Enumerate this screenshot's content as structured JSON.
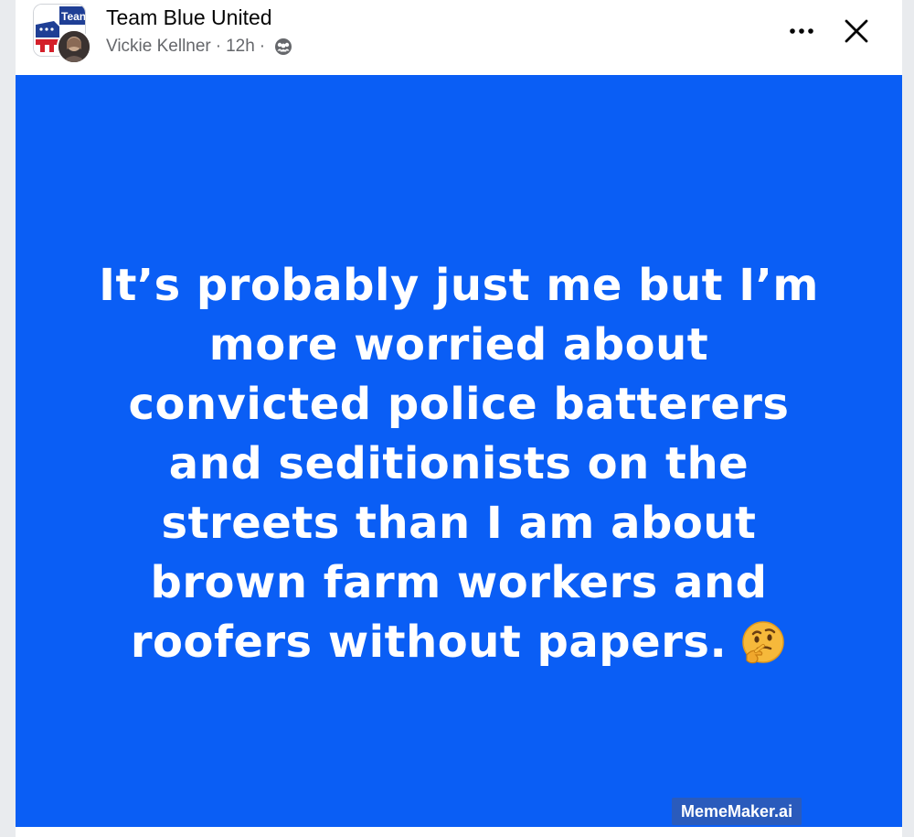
{
  "post": {
    "group_name": "Team Blue United",
    "group_logo_text": "Tean",
    "author": "Vickie Kellner",
    "separator": "·",
    "time": "12h",
    "audience_icon": "group-members-icon",
    "more_icon": "more-options-icon",
    "close_icon": "close-icon"
  },
  "meme": {
    "text": "It’s probably just me but I’m\nmore worried about\nconvicted police batterers\nand seditionists on the\nstreets  than I am about\nbrown farm workers and\nroofers without papers.",
    "emoji": "thinking-face-icon",
    "watermark": "MemeMaker.ai",
    "background_color": "#0a5ef5",
    "text_color": "#ffffff"
  }
}
